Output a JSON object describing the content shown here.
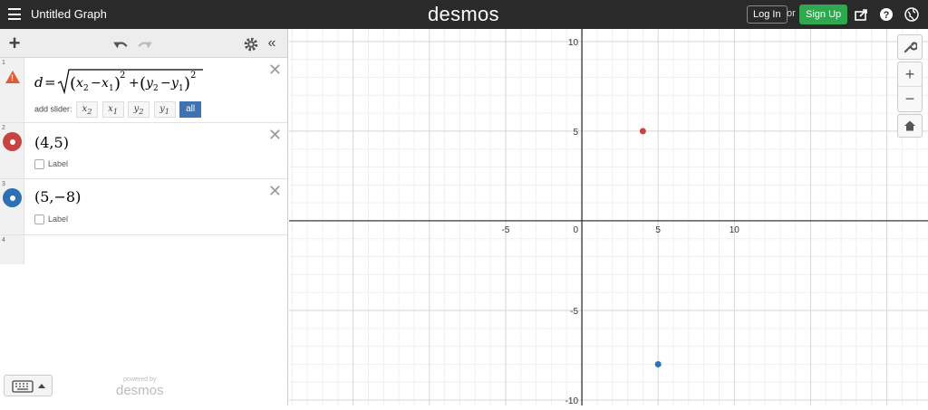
{
  "topbar": {
    "title": "Untitled Graph",
    "logo": "desmos",
    "login_label": "Log In",
    "or_label": "or",
    "signup_label": "Sign Up"
  },
  "expressions": [
    {
      "num": "1",
      "latex_text": "d = √((x₂ − x₁)² + (y₂ − y₁)²)",
      "warning": true,
      "add_slider_label": "add slider:",
      "slider_chips": [
        "x2",
        "x1",
        "y2",
        "y1",
        "all"
      ]
    },
    {
      "num": "2",
      "text": "(4,5)",
      "color": "#c74440",
      "label_text": "Label"
    },
    {
      "num": "3",
      "text": "(5,−8)",
      "color": "#2d70b3",
      "label_text": "Label"
    },
    {
      "num": "4"
    }
  ],
  "powered_by": {
    "line1": "powered by",
    "line2": "desmos"
  },
  "graph": {
    "xlim": [
      -19.2,
      22.7
    ],
    "ylim": [
      -10.3,
      10.7
    ],
    "x_ticks": [
      "-5",
      "0",
      "5",
      "10"
    ],
    "y_ticks": [
      "10",
      "5",
      "-5",
      "-10"
    ],
    "points": [
      {
        "x": 4,
        "y": 5,
        "color": "#c74440"
      },
      {
        "x": 5,
        "y": -8,
        "color": "#2d70b3"
      }
    ]
  }
}
